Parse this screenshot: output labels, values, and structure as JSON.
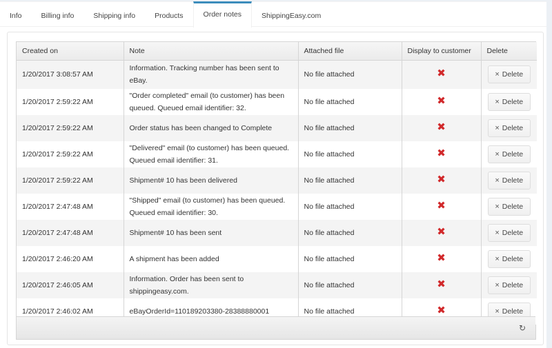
{
  "tabs": [
    {
      "label": "Info",
      "active": false
    },
    {
      "label": "Billing info",
      "active": false
    },
    {
      "label": "Shipping info",
      "active": false
    },
    {
      "label": "Products",
      "active": false
    },
    {
      "label": "Order notes",
      "active": true
    },
    {
      "label": "ShippingEasy.com",
      "active": false
    }
  ],
  "grid": {
    "columns": [
      "Created on",
      "Note",
      "Attached file",
      "Display to customer",
      "Delete"
    ],
    "rows": [
      {
        "created_on": "1/20/2017 3:08:57 AM",
        "note": "Information. Tracking number has been sent to eBay.",
        "attached_file": "No file attached",
        "display_to_customer": false,
        "delete_label": "Delete"
      },
      {
        "created_on": "1/20/2017 2:59:22 AM",
        "note": "\"Order completed\" email (to customer) has been queued. Queued email identifier: 32.",
        "attached_file": "No file attached",
        "display_to_customer": false,
        "delete_label": "Delete"
      },
      {
        "created_on": "1/20/2017 2:59:22 AM",
        "note": "Order status has been changed to Complete",
        "attached_file": "No file attached",
        "display_to_customer": false,
        "delete_label": "Delete"
      },
      {
        "created_on": "1/20/2017 2:59:22 AM",
        "note": "\"Delivered\" email (to customer) has been queued. Queued email identifier: 31.",
        "attached_file": "No file attached",
        "display_to_customer": false,
        "delete_label": "Delete"
      },
      {
        "created_on": "1/20/2017 2:59:22 AM",
        "note": "Shipment# 10 has been delivered",
        "attached_file": "No file attached",
        "display_to_customer": false,
        "delete_label": "Delete"
      },
      {
        "created_on": "1/20/2017 2:47:48 AM",
        "note": "\"Shipped\" email (to customer) has been queued. Queued email identifier: 30.",
        "attached_file": "No file attached",
        "display_to_customer": false,
        "delete_label": "Delete"
      },
      {
        "created_on": "1/20/2017 2:47:48 AM",
        "note": "Shipment# 10 has been sent",
        "attached_file": "No file attached",
        "display_to_customer": false,
        "delete_label": "Delete"
      },
      {
        "created_on": "1/20/2017 2:46:20 AM",
        "note": "A shipment has been added",
        "attached_file": "No file attached",
        "display_to_customer": false,
        "delete_label": "Delete"
      },
      {
        "created_on": "1/20/2017 2:46:05 AM",
        "note": "Information. Order has been sent to shippingeasy.com.",
        "attached_file": "No file attached",
        "display_to_customer": false,
        "delete_label": "Delete"
      },
      {
        "created_on": "1/20/2017 2:46:02 AM",
        "note": "eBayOrderId=110189203380-28388880001",
        "attached_file": "No file attached",
        "display_to_customer": false,
        "delete_label": "Delete"
      }
    ]
  },
  "icons": {
    "false_mark": "✖",
    "delete_icon": "×",
    "refresh_icon": "↻"
  },
  "colors": {
    "accent": "#3c8dbc",
    "false_mark": "#d1292b"
  }
}
